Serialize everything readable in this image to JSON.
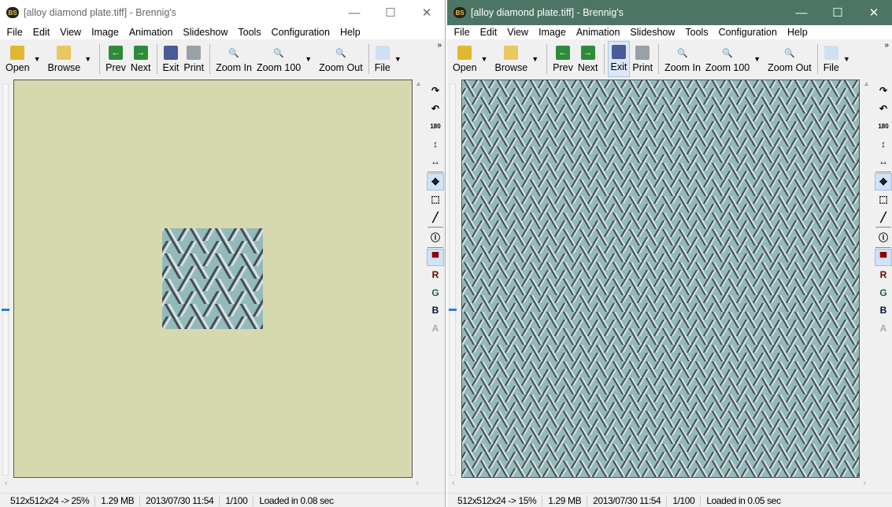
{
  "windows": [
    {
      "title": "[alloy diamond plate.tiff] - Brennig's",
      "active": false,
      "status": [
        "512x512x24 -> 25%",
        "1.29 MB",
        "2013/07/30 11:54",
        "1/100",
        "Loaded in 0.08 sec"
      ],
      "active_tool": "Exit-none",
      "full_image": false
    },
    {
      "title": "[alloy diamond plate.tiff] - Brennig's",
      "active": true,
      "status": [
        "512x512x24 -> 15%",
        "1.29 MB",
        "2013/07/30 11:54",
        "1/100",
        "Loaded in 0.05 sec"
      ],
      "active_tool": "Exit",
      "full_image": true
    }
  ],
  "logo": "BS",
  "window_buttons": {
    "minimize": "—",
    "maximize": "☐",
    "close": "✕"
  },
  "menu": [
    "File",
    "Edit",
    "View",
    "Image",
    "Animation",
    "Slideshow",
    "Tools",
    "Configuration",
    "Help"
  ],
  "toolbar": [
    {
      "label": "Open",
      "icon": "open-folder-icon",
      "color": "#e0b830",
      "glyph": "",
      "dropdown": true
    },
    {
      "label": "Browse",
      "icon": "browse-folder-icon",
      "color": "#e8c860",
      "glyph": "",
      "dropdown": true,
      "sep_after": true
    },
    {
      "label": "Prev",
      "icon": "arrow-left-icon",
      "color": "#2e8b3a",
      "glyph": "←"
    },
    {
      "label": "Next",
      "icon": "arrow-right-icon",
      "color": "#2e8b3a",
      "glyph": "→",
      "sep_after": true
    },
    {
      "label": "Exit",
      "icon": "exit-door-icon",
      "color": "#4a5a9a",
      "glyph": ""
    },
    {
      "label": "Print",
      "icon": "printer-icon",
      "color": "#9aa0a8",
      "glyph": "",
      "sep_after": true
    },
    {
      "label": "Zoom In",
      "icon": "zoom-in-icon",
      "color": "transparent",
      "glyph": "🔍"
    },
    {
      "label": "Zoom 100",
      "icon": "zoom-100-icon",
      "color": "transparent",
      "glyph": "🔍",
      "dropdown": true
    },
    {
      "label": "Zoom Out",
      "icon": "zoom-out-icon",
      "color": "transparent",
      "glyph": "🔍",
      "sep_after": true
    },
    {
      "label": "File",
      "icon": "file-icon",
      "color": "#cfe0f4",
      "glyph": "",
      "dropdown": true
    }
  ],
  "more": "»",
  "side_tools": [
    {
      "name": "rotate-cw",
      "glyph": "↷"
    },
    {
      "name": "rotate-ccw",
      "glyph": "↶"
    },
    {
      "name": "rotate-180",
      "glyph": "180"
    },
    {
      "name": "flip-vertical",
      "glyph": "↕"
    },
    {
      "name": "flip-horizontal",
      "glyph": "↔",
      "sep_after": true
    },
    {
      "name": "move",
      "glyph": "✥",
      "active": true
    },
    {
      "name": "select",
      "glyph": "⬚"
    },
    {
      "name": "draw-line",
      "glyph": "╱",
      "sep_after": true
    },
    {
      "name": "info",
      "glyph": "ⓘ",
      "sep_after": true
    },
    {
      "name": "color-channels",
      "glyph": "▀",
      "active": true
    },
    {
      "name": "red-channel",
      "glyph": "R"
    },
    {
      "name": "green-channel",
      "glyph": "G"
    },
    {
      "name": "blue-channel",
      "glyph": "B"
    },
    {
      "name": "alpha-channel",
      "glyph": "A"
    }
  ]
}
